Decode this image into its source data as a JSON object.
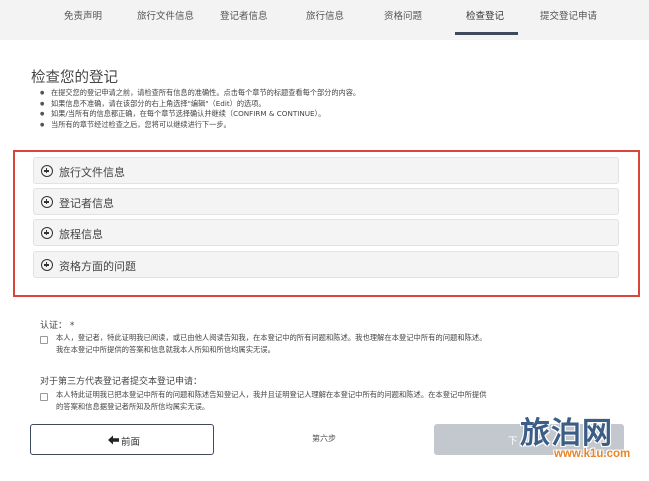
{
  "tabs": [
    {
      "label": "免责声明"
    },
    {
      "label": "旅行文件信息"
    },
    {
      "label": "登记者信息"
    },
    {
      "label": "旅行信息"
    },
    {
      "label": "资格问题"
    },
    {
      "label": "检查登记"
    },
    {
      "label": "提交登记申请"
    }
  ],
  "active_tab": "检查登记",
  "page": {
    "title": "检查您的登记",
    "instructions": [
      "在提交您的登记申请之前，请检查所有信息的准确性。点击每个章节的标题查看每个部分的内容。",
      "如果信息不准确，请在该部分的右上角选择\"编辑\"（Edit）的选项。",
      "如果/当所有的信息都正确，在每个章节选择确认并继续（CONFIRM & CONTINUE）。",
      "当所有的章节经过检查之后，您将可以继续进行下一步。"
    ]
  },
  "sections": [
    {
      "label": "旅行文件信息"
    },
    {
      "label": "登记者信息"
    },
    {
      "label": "旅程信息"
    },
    {
      "label": "资格方面的问题"
    }
  ],
  "certification": {
    "label": "认证：",
    "required_mark": "*",
    "self_line1": "本人，登记者，特此证明我已阅读，或已由他人阅读告知我，在本登记中的所有问题和陈述。我也理解在本登记中所有的问题和陈述。",
    "self_line2": "我在本登记中所提供的答案和信息就我本人所知和所信均属实无误。",
    "third_party_label": "对于第三方代表登记者提交本登记申请：",
    "third_line1": "本人特此证明我已把本登记中所有的问题和陈述告知登记人，我并且证明登记人理解在本登记中所有的问题和陈述。在本登记中所提供",
    "third_line2": "的答案和信息据登记者所知及所信均属实无误。"
  },
  "footer": {
    "prev_label": "前面",
    "step_label": "第六步",
    "next_label": "下"
  },
  "watermark": {
    "title": "旅泊网",
    "url": "www.k1u.com"
  },
  "colors": {
    "accent": "#3d4a5c",
    "highlight_border": "#d9443c",
    "disabled_button": "#c3c8cf",
    "watermark_blue": "#3b5d86",
    "watermark_orange": "#e8842a"
  }
}
